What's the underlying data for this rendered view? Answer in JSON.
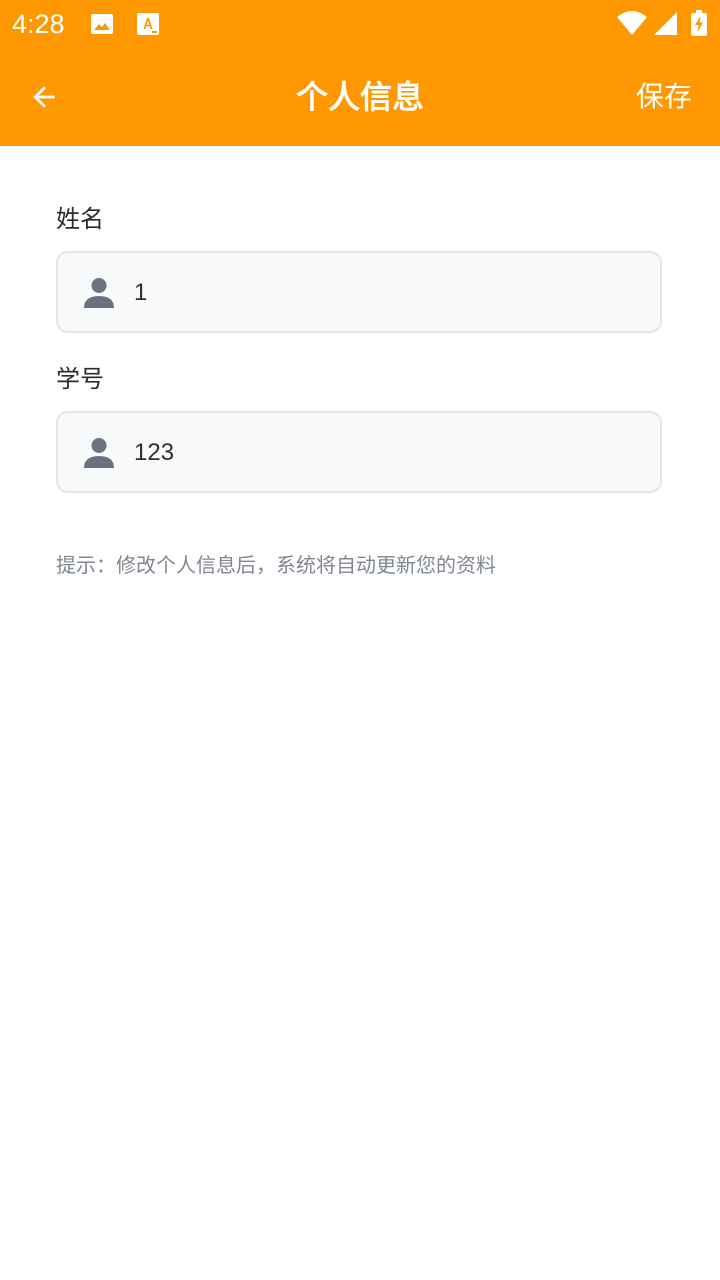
{
  "status_bar": {
    "time": "4:28",
    "left_icons": [
      "image-icon",
      "text-a-icon"
    ],
    "right_icons": [
      "wifi-icon",
      "signal-icon",
      "battery-charging-icon"
    ]
  },
  "header": {
    "title": "个人信息",
    "save_label": "保存",
    "back_icon": "arrow-left-icon"
  },
  "form": {
    "name_label": "姓名",
    "name_value": "1",
    "student_id_label": "学号",
    "student_id_value": "123",
    "field_icon": "person-icon"
  },
  "hint": "提示：修改个人信息后，系统将自动更新您的资料",
  "colors": {
    "primary": "#FF9800",
    "input_background": "#F8F9FB",
    "input_border": "#E3E5E8",
    "hint_text": "#808790"
  }
}
